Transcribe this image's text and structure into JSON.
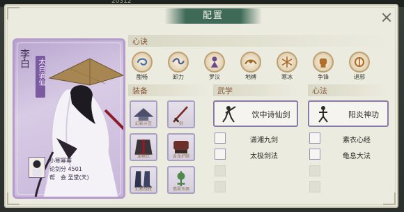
{
  "background": {
    "top_text": "20312"
  },
  "window": {
    "title": "配置"
  },
  "character": {
    "name": "李白",
    "title_badge": "太白谪仙",
    "nickname": "小寒幂幂",
    "sword_score": "论剑分 4501",
    "faction": "帮　会 圣堂(天)"
  },
  "sections": {
    "xinjue": "心诀",
    "zhuangbei": "装备",
    "wuxue": "武学",
    "xinfa": "心法"
  },
  "skills": [
    {
      "label": "酣畅",
      "icon": "swirl-icon"
    },
    {
      "label": "卸力",
      "icon": "wave-icon"
    },
    {
      "label": "罗汉",
      "icon": "monk-icon"
    },
    {
      "label": "地缚",
      "icon": "ground-icon"
    },
    {
      "label": "寒冰",
      "icon": "ice-icon"
    },
    {
      "label": "争锋",
      "icon": "fist-icon"
    },
    {
      "label": "退邪",
      "icon": "ward-icon"
    }
  ],
  "equipment": [
    {
      "label": "幻影斗笠",
      "icon": "hat-icon"
    },
    {
      "label": "剑",
      "icon": "sword-icon"
    },
    {
      "label": "龙鳞衣",
      "icon": "robe-icon"
    },
    {
      "label": "金龙护腕",
      "icon": "bracer-icon"
    },
    {
      "label": "幻影战靴",
      "icon": "boots-icon"
    },
    {
      "label": "翡翠玉佩",
      "icon": "jade-icon"
    }
  ],
  "martial": {
    "main": "饮中诗仙剑",
    "secondary": [
      "潇湘九剑",
      "太极剑法"
    ]
  },
  "heart": {
    "main": "阳炎神功",
    "secondary": [
      "素衣心经",
      "龟息大法"
    ]
  },
  "colors": {
    "card_border": "#b49acd",
    "title_bar": "#3f6a58",
    "section_text": "#8a5a3a"
  }
}
